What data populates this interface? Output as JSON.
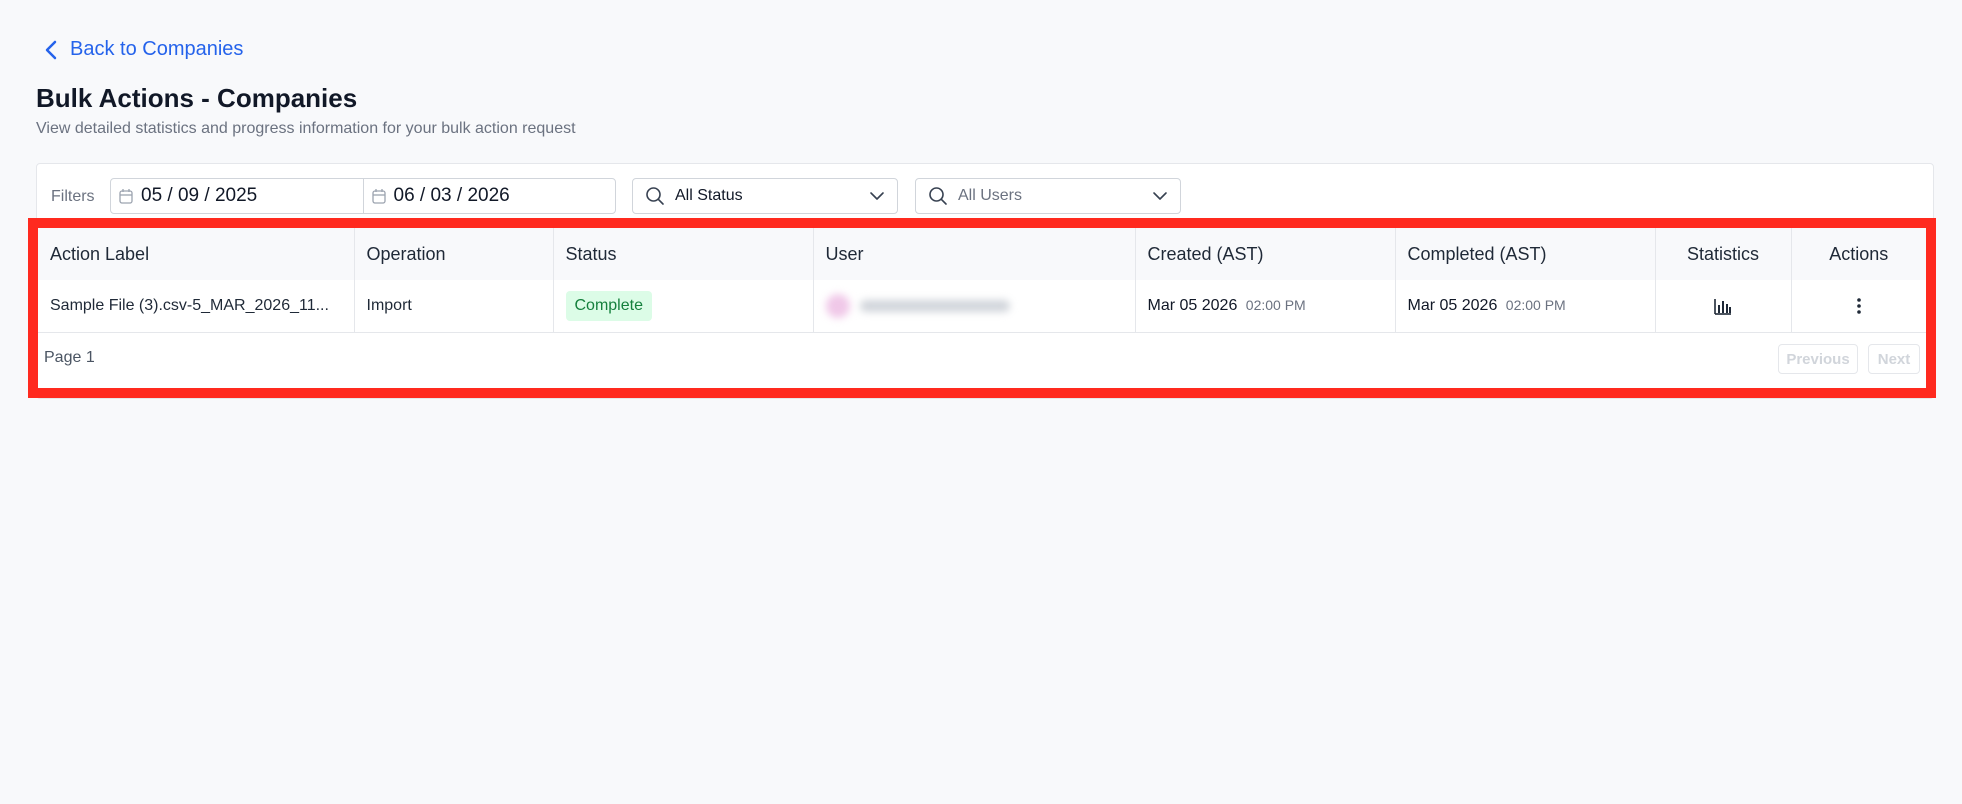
{
  "nav": {
    "back_label": "Back to Companies"
  },
  "header": {
    "title": "Bulk Actions - Companies",
    "subtitle": "View detailed statistics and progress information for your bulk action request"
  },
  "filters": {
    "label": "Filters",
    "date_from": "05 / 09 / 2025",
    "date_to": "06 / 03 / 2026",
    "status_value": "All Status",
    "users_placeholder": "All Users"
  },
  "table": {
    "columns": [
      "Action Label",
      "Operation",
      "Status",
      "User",
      "Created (AST)",
      "Completed (AST)",
      "Statistics",
      "Actions"
    ],
    "rows": [
      {
        "action_label": "Sample File (3).csv-5_MAR_2026_11...",
        "operation": "Import",
        "status": "Complete",
        "created_date": "Mar 05 2026",
        "created_time": "02:00 PM",
        "completed_date": "Mar 05 2026",
        "completed_time": "02:00 PM"
      }
    ]
  },
  "pagination": {
    "page_label": "Page 1",
    "previous_label": "Previous",
    "next_label": "Next"
  },
  "colors": {
    "accent": "#2563eb",
    "highlight": "#ff2a1f",
    "status_complete_bg": "#dcfce7",
    "status_complete_text": "#15803d"
  }
}
